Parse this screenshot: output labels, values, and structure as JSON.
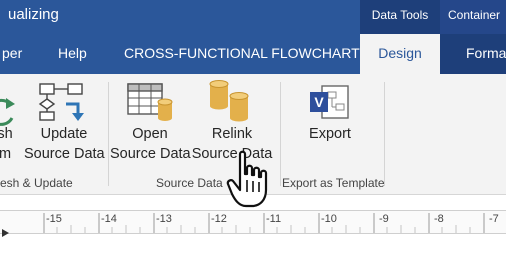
{
  "title_bar": {
    "app_title": "ualizing",
    "context_labels": [
      "Data Tools",
      "Container"
    ]
  },
  "tabs": {
    "developer": "per",
    "help": "Help",
    "context_group": "CROSS-FUNCTIONAL FLOWCHART",
    "design": "Design",
    "format": "Forma"
  },
  "ribbon": {
    "buttons": {
      "refresh": [
        "esh",
        "am"
      ],
      "update": [
        "Update",
        "Source Data"
      ],
      "open": [
        "Open",
        "Source Data"
      ],
      "relink": [
        "Relink",
        "Source Data"
      ],
      "export": [
        "Export",
        ""
      ]
    },
    "groups": {
      "refresh_update": "esh & Update",
      "source_data": "Source Data",
      "export_template": "Export as Template"
    }
  },
  "ruler": {
    "marks": [
      "-15",
      "-14",
      "-13",
      "-12",
      "-11",
      "-10",
      "-9",
      "-8",
      "-7"
    ]
  },
  "colors": {
    "ribbon_blue": "#2b579a",
    "context_dark": "#1e3f7a",
    "ribbon_bg": "#f3f3f3",
    "icon_gold": "#e3b04b",
    "icon_blue": "#2e75b6"
  }
}
